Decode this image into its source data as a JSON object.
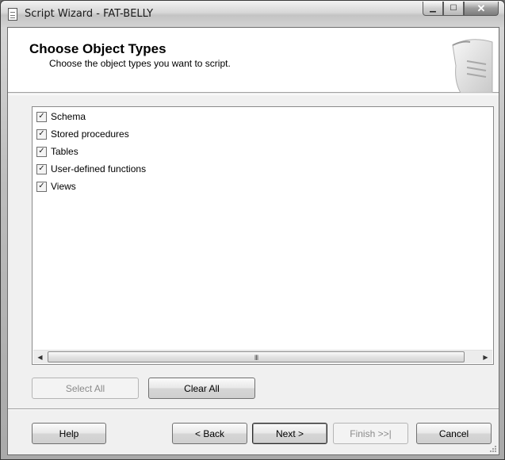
{
  "window": {
    "title": "Script Wizard - FAT-BELLY",
    "minimize_icon": "minimize-icon",
    "maximize_icon": "maximize-icon",
    "close_icon": "close-icon"
  },
  "header": {
    "title": "Choose Object Types",
    "subtitle": "Choose the object types you want to script."
  },
  "object_list": {
    "items": [
      {
        "label": "Schema",
        "checked": true
      },
      {
        "label": "Stored procedures",
        "checked": true
      },
      {
        "label": "Tables",
        "checked": true
      },
      {
        "label": "User-defined functions",
        "checked": true
      },
      {
        "label": "Views",
        "checked": true
      }
    ],
    "scroll_grip": "III"
  },
  "selection_buttons": {
    "select_all": "Select All",
    "clear_all": "Clear All"
  },
  "nav_buttons": {
    "help": "Help",
    "back": "< Back",
    "next": "Next >",
    "finish": "Finish >>|",
    "cancel": "Cancel"
  },
  "colors": {
    "client_bg": "#f0f0f0",
    "header_bg": "#ffffff",
    "disabled_text": "#8a8a8a"
  }
}
